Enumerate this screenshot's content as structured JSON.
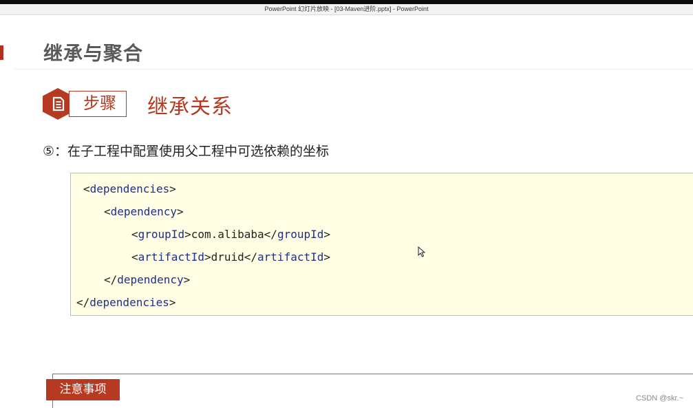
{
  "window": {
    "title": "PowerPoint 幻灯片放映 - [03-Maven进阶.pptx] - PowerPoint"
  },
  "slide": {
    "title": "继承与聚合",
    "step_label": "步骤",
    "step_heading": "继承关系",
    "instruction": "⑤：在子工程中配置使用父工程中可选依赖的坐标",
    "code": {
      "line1": {
        "open": "<",
        "tag": "dependencies",
        "close": ">"
      },
      "line2": {
        "open": "<",
        "tag": "dependency",
        "close": ">"
      },
      "line3": {
        "open": "<",
        "tag": "groupId",
        "mid": ">com.alibaba</",
        "tag2": "groupId",
        "close": ">"
      },
      "line4": {
        "open": "<",
        "tag": "artifactId",
        "mid": ">druid</",
        "tag2": "artifactId",
        "close": ">"
      },
      "line5": {
        "open": "</",
        "tag": "dependency",
        "close": ">"
      },
      "line6": {
        "open": "</",
        "tag": "dependencies",
        "close": ">"
      }
    },
    "notice_label": "注意事项"
  },
  "watermark": "CSDN @skr.~",
  "colors": {
    "accent": "#b63a22",
    "code_bg": "#fffde3",
    "tag": "#1f2f8c",
    "title_gray": "#595959"
  },
  "icons": {
    "step_icon": "document-list-icon",
    "cursor": "mouse-pointer-icon"
  }
}
